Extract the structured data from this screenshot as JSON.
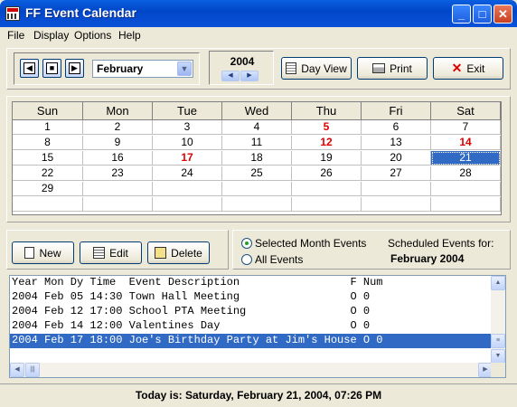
{
  "window": {
    "title": "FF Event Calendar",
    "minimize": "_",
    "maximize": "□",
    "close": "✕"
  },
  "menu": [
    "File",
    "Display",
    "Options",
    "Help"
  ],
  "toolbar": {
    "month": "February",
    "year": "2004",
    "day_view": "Day View",
    "print": "Print",
    "exit": "Exit"
  },
  "calendar": {
    "weekdays": [
      "Sun",
      "Mon",
      "Tue",
      "Wed",
      "Thu",
      "Fri",
      "Sat"
    ],
    "weeks": [
      [
        "1",
        "2",
        "3",
        "4",
        "5",
        "6",
        "7"
      ],
      [
        "8",
        "9",
        "10",
        "11",
        "12",
        "13",
        "14"
      ],
      [
        "15",
        "16",
        "17",
        "18",
        "19",
        "20",
        "21"
      ],
      [
        "22",
        "23",
        "24",
        "25",
        "26",
        "27",
        "28"
      ],
      [
        "29",
        "",
        "",
        "",
        "",
        "",
        ""
      ],
      [
        "",
        "",
        "",
        "",
        "",
        "",
        ""
      ]
    ],
    "event_days": [
      "5",
      "12",
      "14",
      "17"
    ],
    "selected_day": "21",
    "event_color": "#e00000",
    "selected_color": "#316ac5"
  },
  "actions": {
    "new": "New",
    "edit": "Edit",
    "delete": "Delete"
  },
  "filter": {
    "option_selected_month": "Selected Month Events",
    "option_all": "All Events",
    "scheduled_label": "Scheduled Events for:",
    "scheduled_value": "February 2004"
  },
  "event_list": {
    "header": "Year Mon Dy Time  Event Description                 F Num",
    "rows": [
      "2004 Feb 05 14:30 Town Hall Meeting                 O 0",
      "2004 Feb 12 17:00 School PTA Meeting                O 0",
      "2004 Feb 14 12:00 Valentines Day                    O 0",
      "2004 Feb 17 18:00 Joe's Birthday Party at Jim's House O 0"
    ],
    "selected_index": 3
  },
  "status": "Today is: Saturday, February 21, 2004, 07:26 PM"
}
